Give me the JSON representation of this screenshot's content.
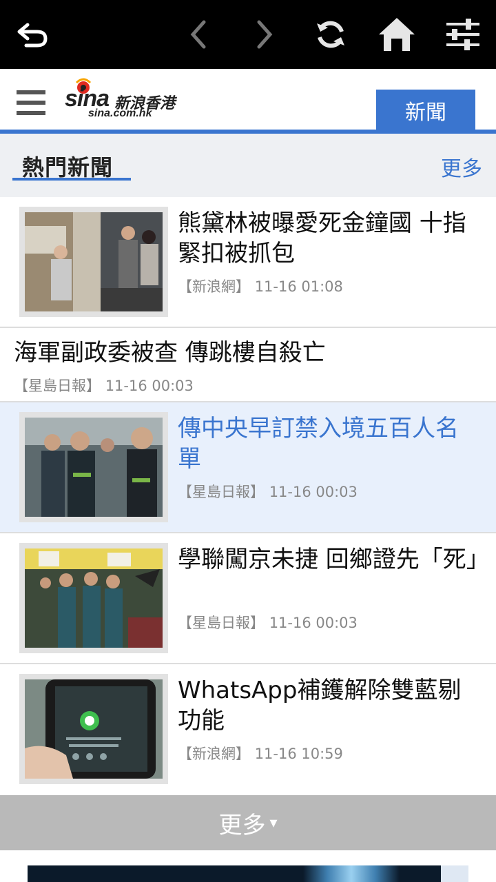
{
  "toolbar": {
    "back_icon": "back-arrow-icon",
    "prev_icon": "chevron-left-icon",
    "next_icon": "chevron-right-icon",
    "refresh_icon": "refresh-icon",
    "home_icon": "home-icon",
    "settings_icon": "sliders-icon"
  },
  "header": {
    "logo_mark": "sina",
    "logo_cn": "新浪香港",
    "logo_domain": "sina.com.hk",
    "active_tab": "新聞",
    "accent_color": "#3a75cf"
  },
  "section": {
    "title": "熱門新聞",
    "more_label": "更多"
  },
  "news": [
    {
      "title": "熊黛林被曝愛死金鐘國 十指緊扣被抓包",
      "source": "【新浪網】",
      "time": "11-16 01:08",
      "has_thumb": true
    },
    {
      "title": "海軍副政委被查 傳跳樓自殺亡",
      "source": "【星島日報】",
      "time": "11-16 00:03",
      "has_thumb": false
    },
    {
      "title": "傳中央早訂禁入境五百人名單",
      "source": "【星島日報】",
      "time": "11-16 00:03",
      "has_thumb": true,
      "selected": true
    },
    {
      "title": "學聯闖京未捷 回鄉證先「死」",
      "source": "【星島日報】",
      "time": "11-16 00:03",
      "has_thumb": true
    },
    {
      "title": "WhatsApp補鑊解除雙藍剔功能",
      "source": "【新浪網】",
      "time": "11-16 10:59",
      "has_thumb": true
    }
  ],
  "load_more": {
    "label": "更多",
    "arrow": "▾"
  }
}
